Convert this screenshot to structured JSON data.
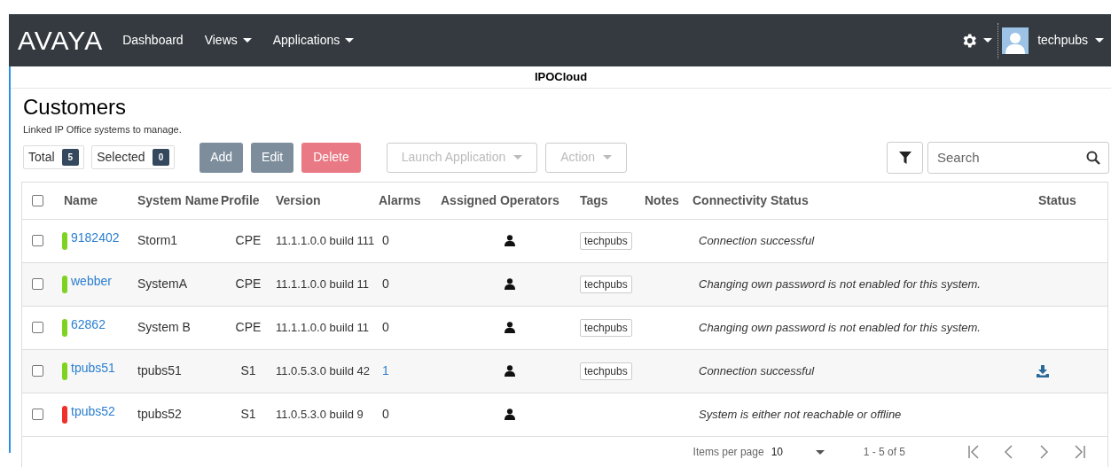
{
  "navbar": {
    "logo": "AVAYA",
    "items": [
      {
        "label": "Dashboard",
        "dropdown": false
      },
      {
        "label": "Views",
        "dropdown": true
      },
      {
        "label": "Applications",
        "dropdown": true
      }
    ],
    "user": "techpubs"
  },
  "subheader": {
    "title": "IPOCloud"
  },
  "page": {
    "title": "Customers",
    "subtitle": "Linked IP Office systems to manage."
  },
  "counters": [
    {
      "label": "Total",
      "count": "5"
    },
    {
      "label": "Selected",
      "count": "0"
    }
  ],
  "buttons": [
    {
      "label": "Add",
      "kind": "add"
    },
    {
      "label": "Edit",
      "kind": "edit"
    },
    {
      "label": "Delete",
      "kind": "danger"
    },
    {
      "label": "Launch Application",
      "kind": "menu",
      "disabled": true
    },
    {
      "label": "Action",
      "kind": "menu",
      "disabled": true
    }
  ],
  "search": {
    "placeholder": "Search"
  },
  "table": {
    "select_all_checked": false,
    "columns": [
      "Name",
      "System Name",
      "Profile",
      "Version",
      "Alarms",
      "Assigned Operators",
      "Tags",
      "Notes",
      "Connectivity Status",
      "Status"
    ],
    "rows": [
      {
        "checked": false,
        "color": "#7ed321",
        "name": "9182402",
        "system_name": "Storm1",
        "profile": "CPE",
        "version": "11.1.1.0.0 build 111",
        "alarms": "0",
        "alarms_link": false,
        "tag": "techpubs",
        "connectivity": "Connection successful",
        "download": false
      },
      {
        "checked": false,
        "color": "#7ed321",
        "name": "webber",
        "system_name": "SystemA",
        "profile": "CPE",
        "version": "11.1.1.0.0 build 11",
        "alarms": "0",
        "alarms_link": false,
        "tag": "techpubs",
        "connectivity": "Changing own password is not enabled for this system.",
        "download": false
      },
      {
        "checked": false,
        "color": "#7ed321",
        "name": "62862",
        "system_name": "System B",
        "profile": "CPE",
        "version": "11.1.1.0.0 build 11",
        "alarms": "0",
        "alarms_link": false,
        "tag": "techpubs",
        "connectivity": "Changing own password is not enabled for this system.",
        "download": false
      },
      {
        "checked": false,
        "color": "#7ed321",
        "name": "tpubs51",
        "system_name": "tpubs51",
        "profile": "S1",
        "version": "11.0.5.3.0 build 42",
        "alarms": "1",
        "alarms_link": true,
        "tag": "techpubs",
        "connectivity": "Connection successful",
        "download": true
      },
      {
        "checked": false,
        "color": "#f0302a",
        "name": "tpubs52",
        "system_name": "tpubs52",
        "profile": "S1",
        "version": "11.0.5.3.0 build 9",
        "alarms": "0",
        "alarms_link": false,
        "connectivity": "System is either not reachable or offline",
        "download": false
      }
    ]
  },
  "pagination": {
    "label": "Items per page",
    "page_size": "10",
    "range": "1 - 5 of 5"
  }
}
